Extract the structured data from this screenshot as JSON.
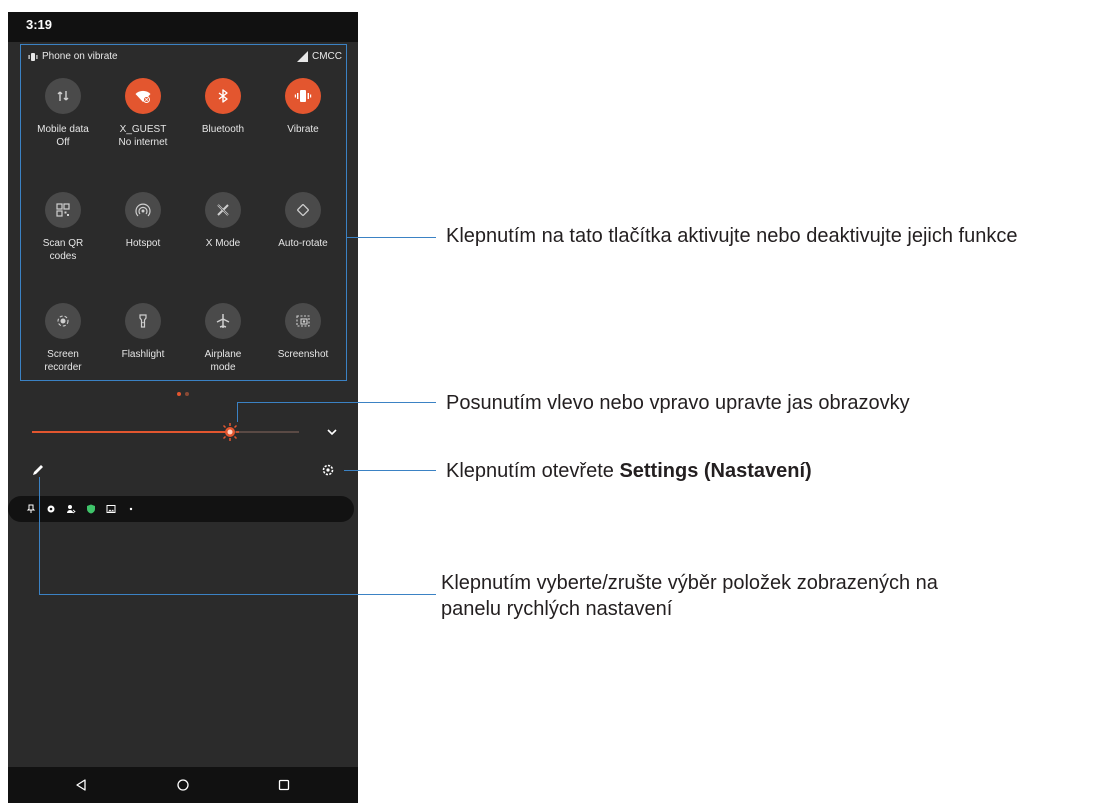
{
  "status_bar": {
    "time": "3:19"
  },
  "quick_settings": {
    "header_left": "Phone on vibrate",
    "header_right": "CMCC",
    "tiles": [
      {
        "label": "Mobile data",
        "sub": "Off",
        "icon": "mobile-data-icon",
        "active": false
      },
      {
        "label": "X_GUEST",
        "sub": "No internet",
        "icon": "wifi-icon",
        "active": true
      },
      {
        "label": "Bluetooth",
        "sub": "",
        "icon": "bluetooth-icon",
        "active": true
      },
      {
        "label": "Vibrate",
        "sub": "",
        "icon": "vibrate-icon",
        "active": true
      },
      {
        "label": "Scan QR",
        "sub": "codes",
        "icon": "qr-code-icon",
        "active": false
      },
      {
        "label": "Hotspot",
        "sub": "",
        "icon": "hotspot-icon",
        "active": false
      },
      {
        "label": "X Mode",
        "sub": "",
        "icon": "x-mode-icon",
        "active": false
      },
      {
        "label": "Auto-rotate",
        "sub": "",
        "icon": "auto-rotate-icon",
        "active": false
      },
      {
        "label": "Screen",
        "sub": "recorder",
        "icon": "screen-recorder-icon",
        "active": false
      },
      {
        "label": "Flashlight",
        "sub": "",
        "icon": "flashlight-icon",
        "active": false
      },
      {
        "label": "Airplane",
        "sub": "mode",
        "icon": "airplane-icon",
        "active": false
      },
      {
        "label": "Screenshot",
        "sub": "",
        "icon": "screenshot-icon",
        "active": false
      }
    ]
  },
  "brightness": {
    "level": 0.74
  },
  "callouts": {
    "tiles": "Klepnutím na tato tlačítka aktivujte nebo deaktivujte jejich funkce",
    "brightness": "Posunutím vlevo nebo vpravo upravte jas obrazovky",
    "settings_prefix": "Klepnutím otevřete ",
    "settings_bold": "Settings (Nastavení)",
    "edit_line1": "Klepnutím vyberte/zrušte výběr položek zobrazených na",
    "edit_line2": "panelu rychlých nastavení"
  },
  "colors": {
    "accent": "#e3562f",
    "callout_line": "#3b82c4"
  }
}
